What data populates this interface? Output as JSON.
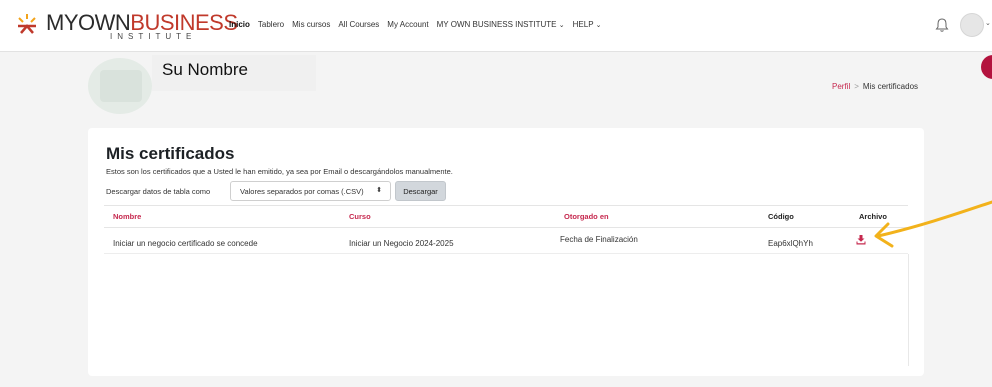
{
  "brand": {
    "name_part1": "MYOWN",
    "name_part2": "BUSINESS",
    "subtitle": "INSTITUTE"
  },
  "nav": {
    "items": [
      {
        "label": "Inicio",
        "active": true
      },
      {
        "label": "Tablero",
        "active": false
      },
      {
        "label": "Mis cursos",
        "active": false
      },
      {
        "label": "All Courses",
        "active": false
      },
      {
        "label": "My Account",
        "active": false
      },
      {
        "label": "MY OWN BUSINESS INSTITUTE",
        "active": false,
        "dropdown": true
      },
      {
        "label": "HELP",
        "active": false,
        "dropdown": true
      }
    ],
    "icons": [
      "bell-icon",
      "user-avatar",
      "chevron-down-icon"
    ]
  },
  "profile": {
    "name": "Su Nombre"
  },
  "breadcrumb": {
    "parent": "Perfil",
    "separator": ">",
    "current": "Mis certificados"
  },
  "page": {
    "title": "Mis certificados",
    "description": "Estos son los certificados que a Usted le han emitido, ya sea por Email o descargándolos manualmente.",
    "export_label": "Descargar datos de tabla como",
    "export_format": "Valores separados por comas (.CSV)",
    "export_button": "Descargar"
  },
  "table": {
    "headers": {
      "nombre": "Nombre",
      "curso": "Curso",
      "otorgado": "Otorgado en",
      "codigo": "Código",
      "archivo": "Archivo"
    },
    "rows": [
      {
        "nombre": "Iniciar un negocio certificado se concede",
        "curso": "Iniciar un Negocio 2024-2025",
        "otorgado": "Fecha de Finalización",
        "codigo": "Eap6xlQhYh",
        "archivo_icon": "download-icon"
      }
    ]
  },
  "colors": {
    "accent": "#c6284e",
    "arrow": "#f2b21b",
    "download": "#c6284e"
  }
}
